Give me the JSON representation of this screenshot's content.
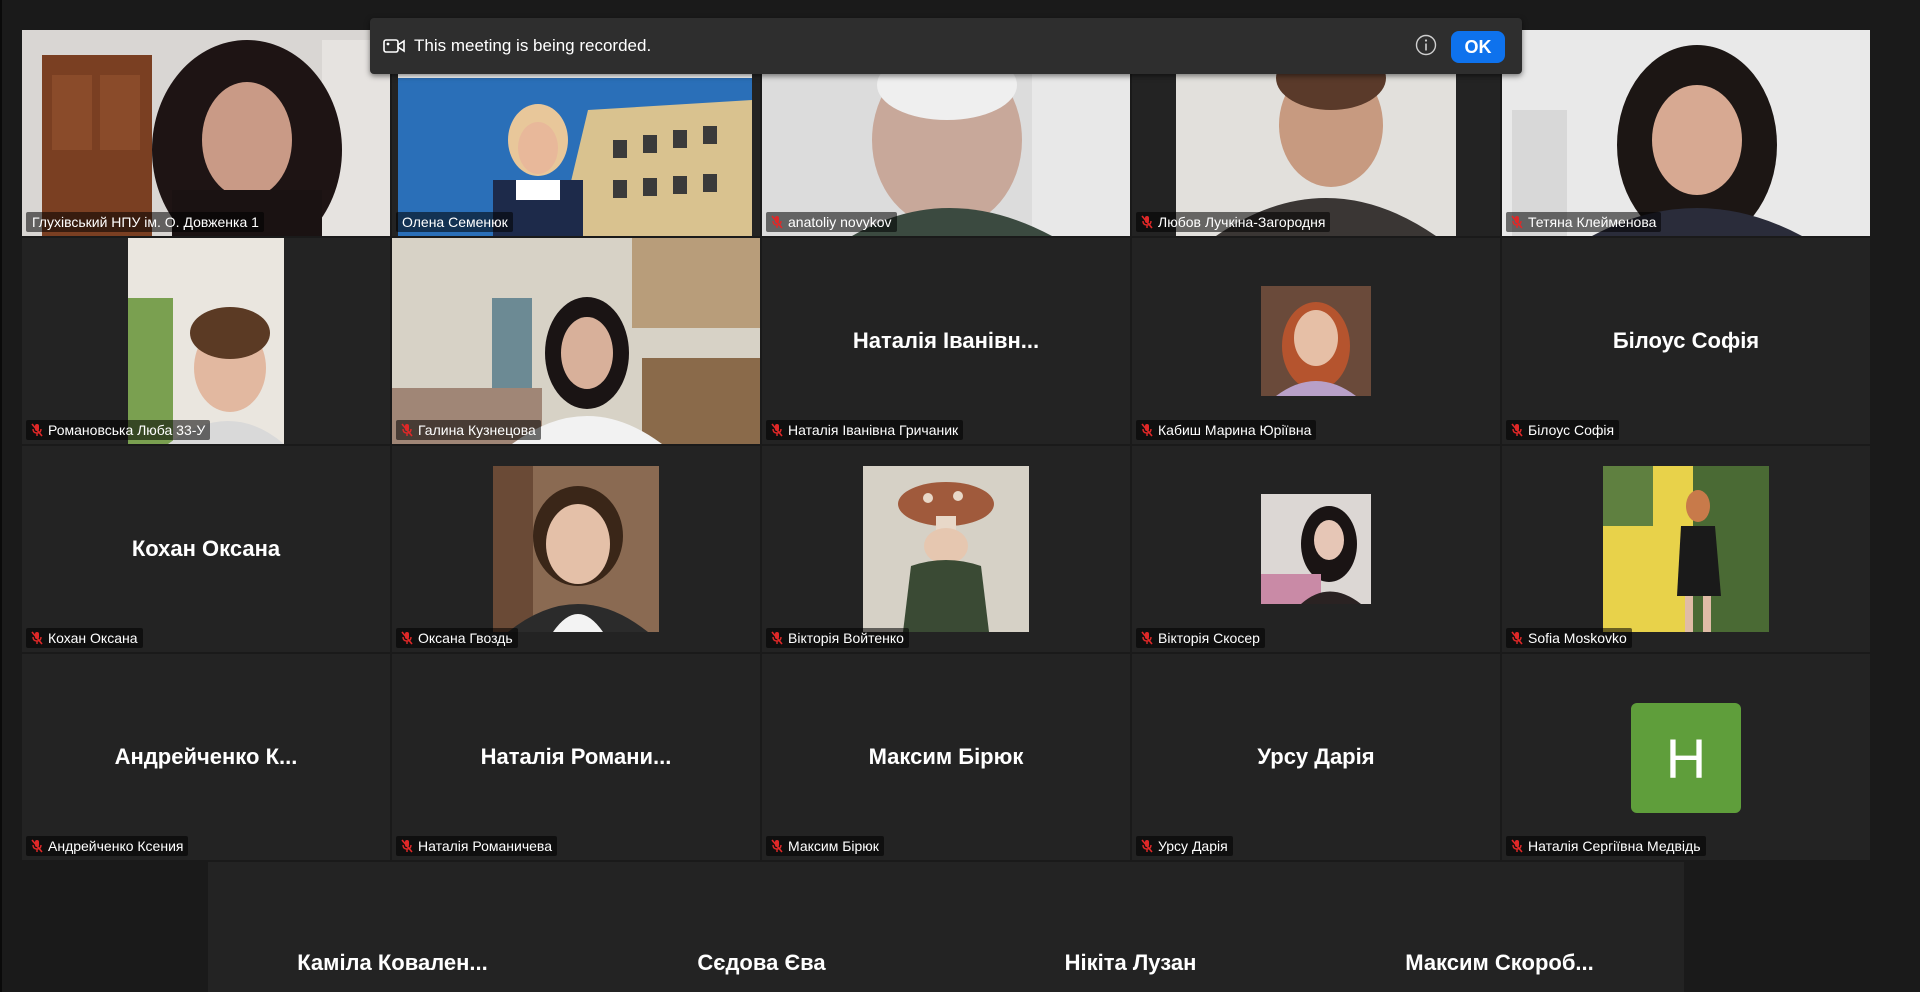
{
  "banner": {
    "text": "This meeting is being recorded.",
    "ok_label": "OK",
    "icon": "video-camera-icon",
    "info_icon": "info-icon"
  },
  "colors": {
    "active_border": "#2fd36b",
    "ok_button": "#0e72ed",
    "muted_mic": "#e02828",
    "letter_avatar_bg": "#5f9e3b"
  },
  "tiles": [
    {
      "label": "Глухівський НПУ ім. О. Довженка 1",
      "video": "video-feed",
      "muted": false,
      "active": true
    },
    {
      "label": "Олена Семенюк",
      "video": "video-feed",
      "muted": false
    },
    {
      "label": "anatoliy novykov",
      "video": "video-feed",
      "muted": true
    },
    {
      "label": "Любов Лучкіна-Загородня",
      "video": "video-feed",
      "muted": true
    },
    {
      "label": "Тетяна Клейменова",
      "video": "video-feed",
      "muted": true
    },
    {
      "label": "Романовська Люба 33-У",
      "video": "video-feed",
      "muted": true
    },
    {
      "label": "Галина Кузнецова",
      "video": "video-feed",
      "muted": true
    },
    {
      "label": "Наталія Іванівна Гричаник",
      "display": "Наталія Іванівн...",
      "muted": true
    },
    {
      "label": "Кабиш Марина Юріївна",
      "video": "profile-photo",
      "muted": true
    },
    {
      "label": "Білоус Софія",
      "display": "Білоус Софія",
      "muted": true
    },
    {
      "label": "Кохан Оксана",
      "display": "Кохан Оксана",
      "muted": true
    },
    {
      "label": "Оксана Гвоздь",
      "video": "profile-photo",
      "muted": true
    },
    {
      "label": "Вікторія Войтенко",
      "video": "profile-photo",
      "muted": true
    },
    {
      "label": "Вікторія Скосер",
      "video": "profile-photo",
      "muted": true
    },
    {
      "label": "Sofia Moskovko",
      "video": "profile-photo",
      "muted": true
    },
    {
      "label": "Андрейченко Ксения",
      "display": "Андрейченко  К...",
      "muted": true
    },
    {
      "label": "Наталія Романичева",
      "display": "Наталія  Романи...",
      "muted": true
    },
    {
      "label": "Максим Бірюк",
      "display": "Максим Бірюк",
      "muted": true
    },
    {
      "label": "Урсу Дарія",
      "display": "Урсу Дарія",
      "muted": true
    },
    {
      "label": "Наталія Сергіївна Медвідь",
      "letter": "Н",
      "muted": true
    }
  ],
  "bottom_row": [
    "Каміла  Ковален...",
    "Сєдова Єва",
    "Нікіта Лузан",
    "Максим  Скороб..."
  ]
}
